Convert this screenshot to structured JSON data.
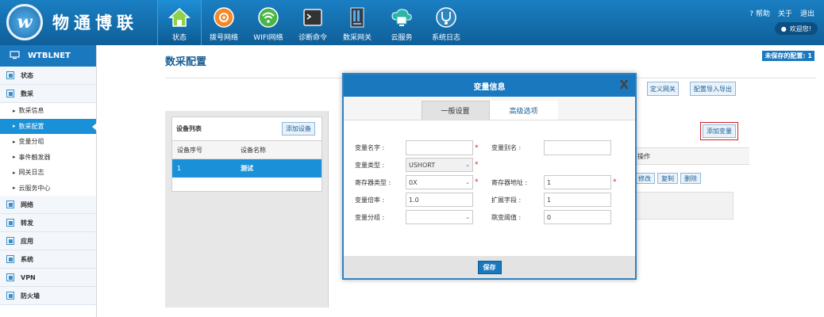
{
  "brand": {
    "logo_letter": "w",
    "name": "物通博联"
  },
  "nav": [
    {
      "label": "状态",
      "icon": "home-icon"
    },
    {
      "label": "拨号网络",
      "icon": "dialup-icon"
    },
    {
      "label": "WIFI网络",
      "icon": "wifi-icon"
    },
    {
      "label": "诊断命令",
      "icon": "terminal-icon"
    },
    {
      "label": "数采网关",
      "icon": "gateway-icon"
    },
    {
      "label": "云服务",
      "icon": "cloud-icon"
    },
    {
      "label": "系统日志",
      "icon": "stethoscope-icon"
    }
  ],
  "top_links": {
    "help": "帮助",
    "about": "关于",
    "logout": "退出",
    "welcome": "欢迎您!"
  },
  "sidebar": {
    "header": "WTBLNET",
    "sections": {
      "status": "状态",
      "data": "数采",
      "network": "网络",
      "forward": "转发",
      "app": "应用",
      "system": "系统",
      "vpn": "VPN",
      "firewall": "防火墙"
    },
    "subitems": [
      "数采信息",
      "数采配置",
      "变量分组",
      "事件触发器",
      "网关日志",
      "云服务中心"
    ]
  },
  "main": {
    "title": "数采配置",
    "unsaved": "未保存的配置: 1",
    "define_gateway": "定义网关",
    "import_export": "配置导入导出",
    "device_list": "设备列表",
    "add_device": "添加设备",
    "col_index": "设备序号",
    "col_name": "设备名称",
    "row_index": "1",
    "row_name": "测试",
    "add_variable": "添加变量",
    "col_ops": "操作",
    "op_edit": "修改",
    "op_copy": "复制",
    "op_delete": "删除"
  },
  "modal": {
    "title": "变量信息",
    "close": "X",
    "tab_general": "一般设置",
    "tab_advanced": "高级选项",
    "var_name_label": "变量名字 :",
    "var_name_value": "",
    "var_alias_label": "变量别名 :",
    "var_alias_value": "",
    "var_type_label": "变量类型 :",
    "var_type_value": "USHORT",
    "reg_type_label": "寄存器类型 :",
    "reg_type_value": "0X",
    "reg_addr_label": "寄存器地址 :",
    "reg_addr_value": "1",
    "rate_label": "变量倍率 :",
    "rate_value": "1.0",
    "ext_label": "扩展字段 :",
    "ext_value": "1",
    "group_label": "变量分组 :",
    "group_value": "",
    "jump_label": "跳变阈值 :",
    "jump_value": "0",
    "required_mark": "*",
    "save": "保存"
  },
  "colors": {
    "header": "#1a7fc2",
    "accent": "#1a90d8",
    "required": "#e02020"
  }
}
